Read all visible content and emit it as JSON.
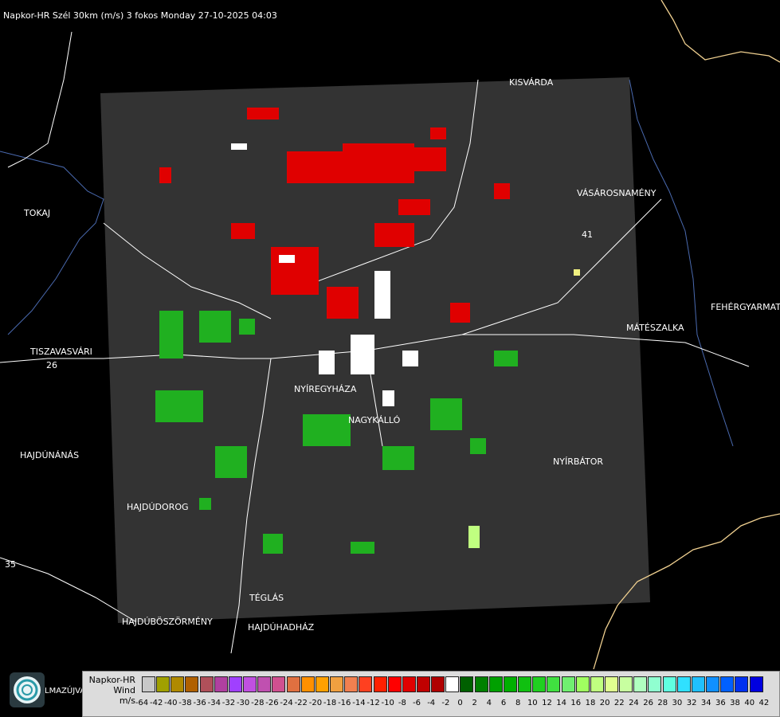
{
  "header": {
    "title": "Napkor-HR Szél 30km (m/s) 3 fokos Monday 27-10-2025 04:03"
  },
  "cities": [
    {
      "name": "KISVÁRDA",
      "id": "kisvarda"
    },
    {
      "name": "VÁSÁROSNAMÉNY",
      "id": "vasarosnameny"
    },
    {
      "name": "TOKAJ",
      "id": "tokaj"
    },
    {
      "name": "FEHÉRGYARMAT",
      "id": "fehergyarmat"
    },
    {
      "name": "MÁTÉSZALKA",
      "id": "mateszalka"
    },
    {
      "name": "TISZAVASVÁRI",
      "id": "tiszavasvari"
    },
    {
      "name": "NYÍREGYHÁZA",
      "id": "nyiregyhaza"
    },
    {
      "name": "NAGYKÁLLÓ",
      "id": "nagykallo"
    },
    {
      "name": "HAJDÚNÁNÁS",
      "id": "hajdunanas"
    },
    {
      "name": "NYÍRBÁTOR",
      "id": "nyirbator"
    },
    {
      "name": "HAJDÚDOROG",
      "id": "hajdudorog"
    },
    {
      "name": "TÉGLÁS",
      "id": "teglas"
    },
    {
      "name": "HAJDÚBÖSZÖRMÉNY",
      "id": "hajduboszormeny"
    },
    {
      "name": "HAJDÚHADHÁZ",
      "id": "hajduhadhaz"
    },
    {
      "name": "LMAZÚJVÁR",
      "id": "lmazujvar"
    }
  ],
  "road_numbers": [
    "26",
    "35",
    "41"
  ],
  "legend": {
    "title_line1": "Napkor-HR",
    "title_line2": "Wind",
    "title_line3": "m/s",
    "colors": [
      "#c8c8c8",
      "#a0a000",
      "#b08a00",
      "#b06000",
      "#b0505a",
      "#b040a0",
      "#a040ff",
      "#c050e0",
      "#c050b0",
      "#d05090",
      "#e07040",
      "#ff9000",
      "#ffa000",
      "#f0a040",
      "#f08050",
      "#ff4020",
      "#ff2000",
      "#ff0000",
      "#e00000",
      "#c00000",
      "#b00000",
      "#ffffff",
      "#006000",
      "#008000",
      "#00a000",
      "#00b000",
      "#10c010",
      "#20d020",
      "#40e040",
      "#70f070",
      "#a0ff60",
      "#c0ff80",
      "#e0ff90",
      "#c8ffa0",
      "#b0ffc0",
      "#90ffd0",
      "#60ffe0",
      "#30e0ff",
      "#20c0ff",
      "#1090ff",
      "#0060ff",
      "#0030f0",
      "#0000e0"
    ],
    "ticks": [
      "-64",
      "-42",
      "-40",
      "-38",
      "-36",
      "-34",
      "-32",
      "-30",
      "-28",
      "-26",
      "-24",
      "-22",
      "-20",
      "-18",
      "-16",
      "-14",
      "-12",
      "-10",
      "-8",
      "-6",
      "-4",
      "-2",
      "0",
      "2",
      "4",
      "6",
      "8",
      "10",
      "12",
      "14",
      "16",
      "18",
      "20",
      "22",
      "24",
      "26",
      "28",
      "30",
      "32",
      "34",
      "36",
      "38",
      "40",
      "42"
    ]
  },
  "colors": {
    "radar_background": "#333333",
    "border_line": "#f0d090",
    "river_line": "#4a6ab0",
    "road_line": "#ffffff"
  }
}
